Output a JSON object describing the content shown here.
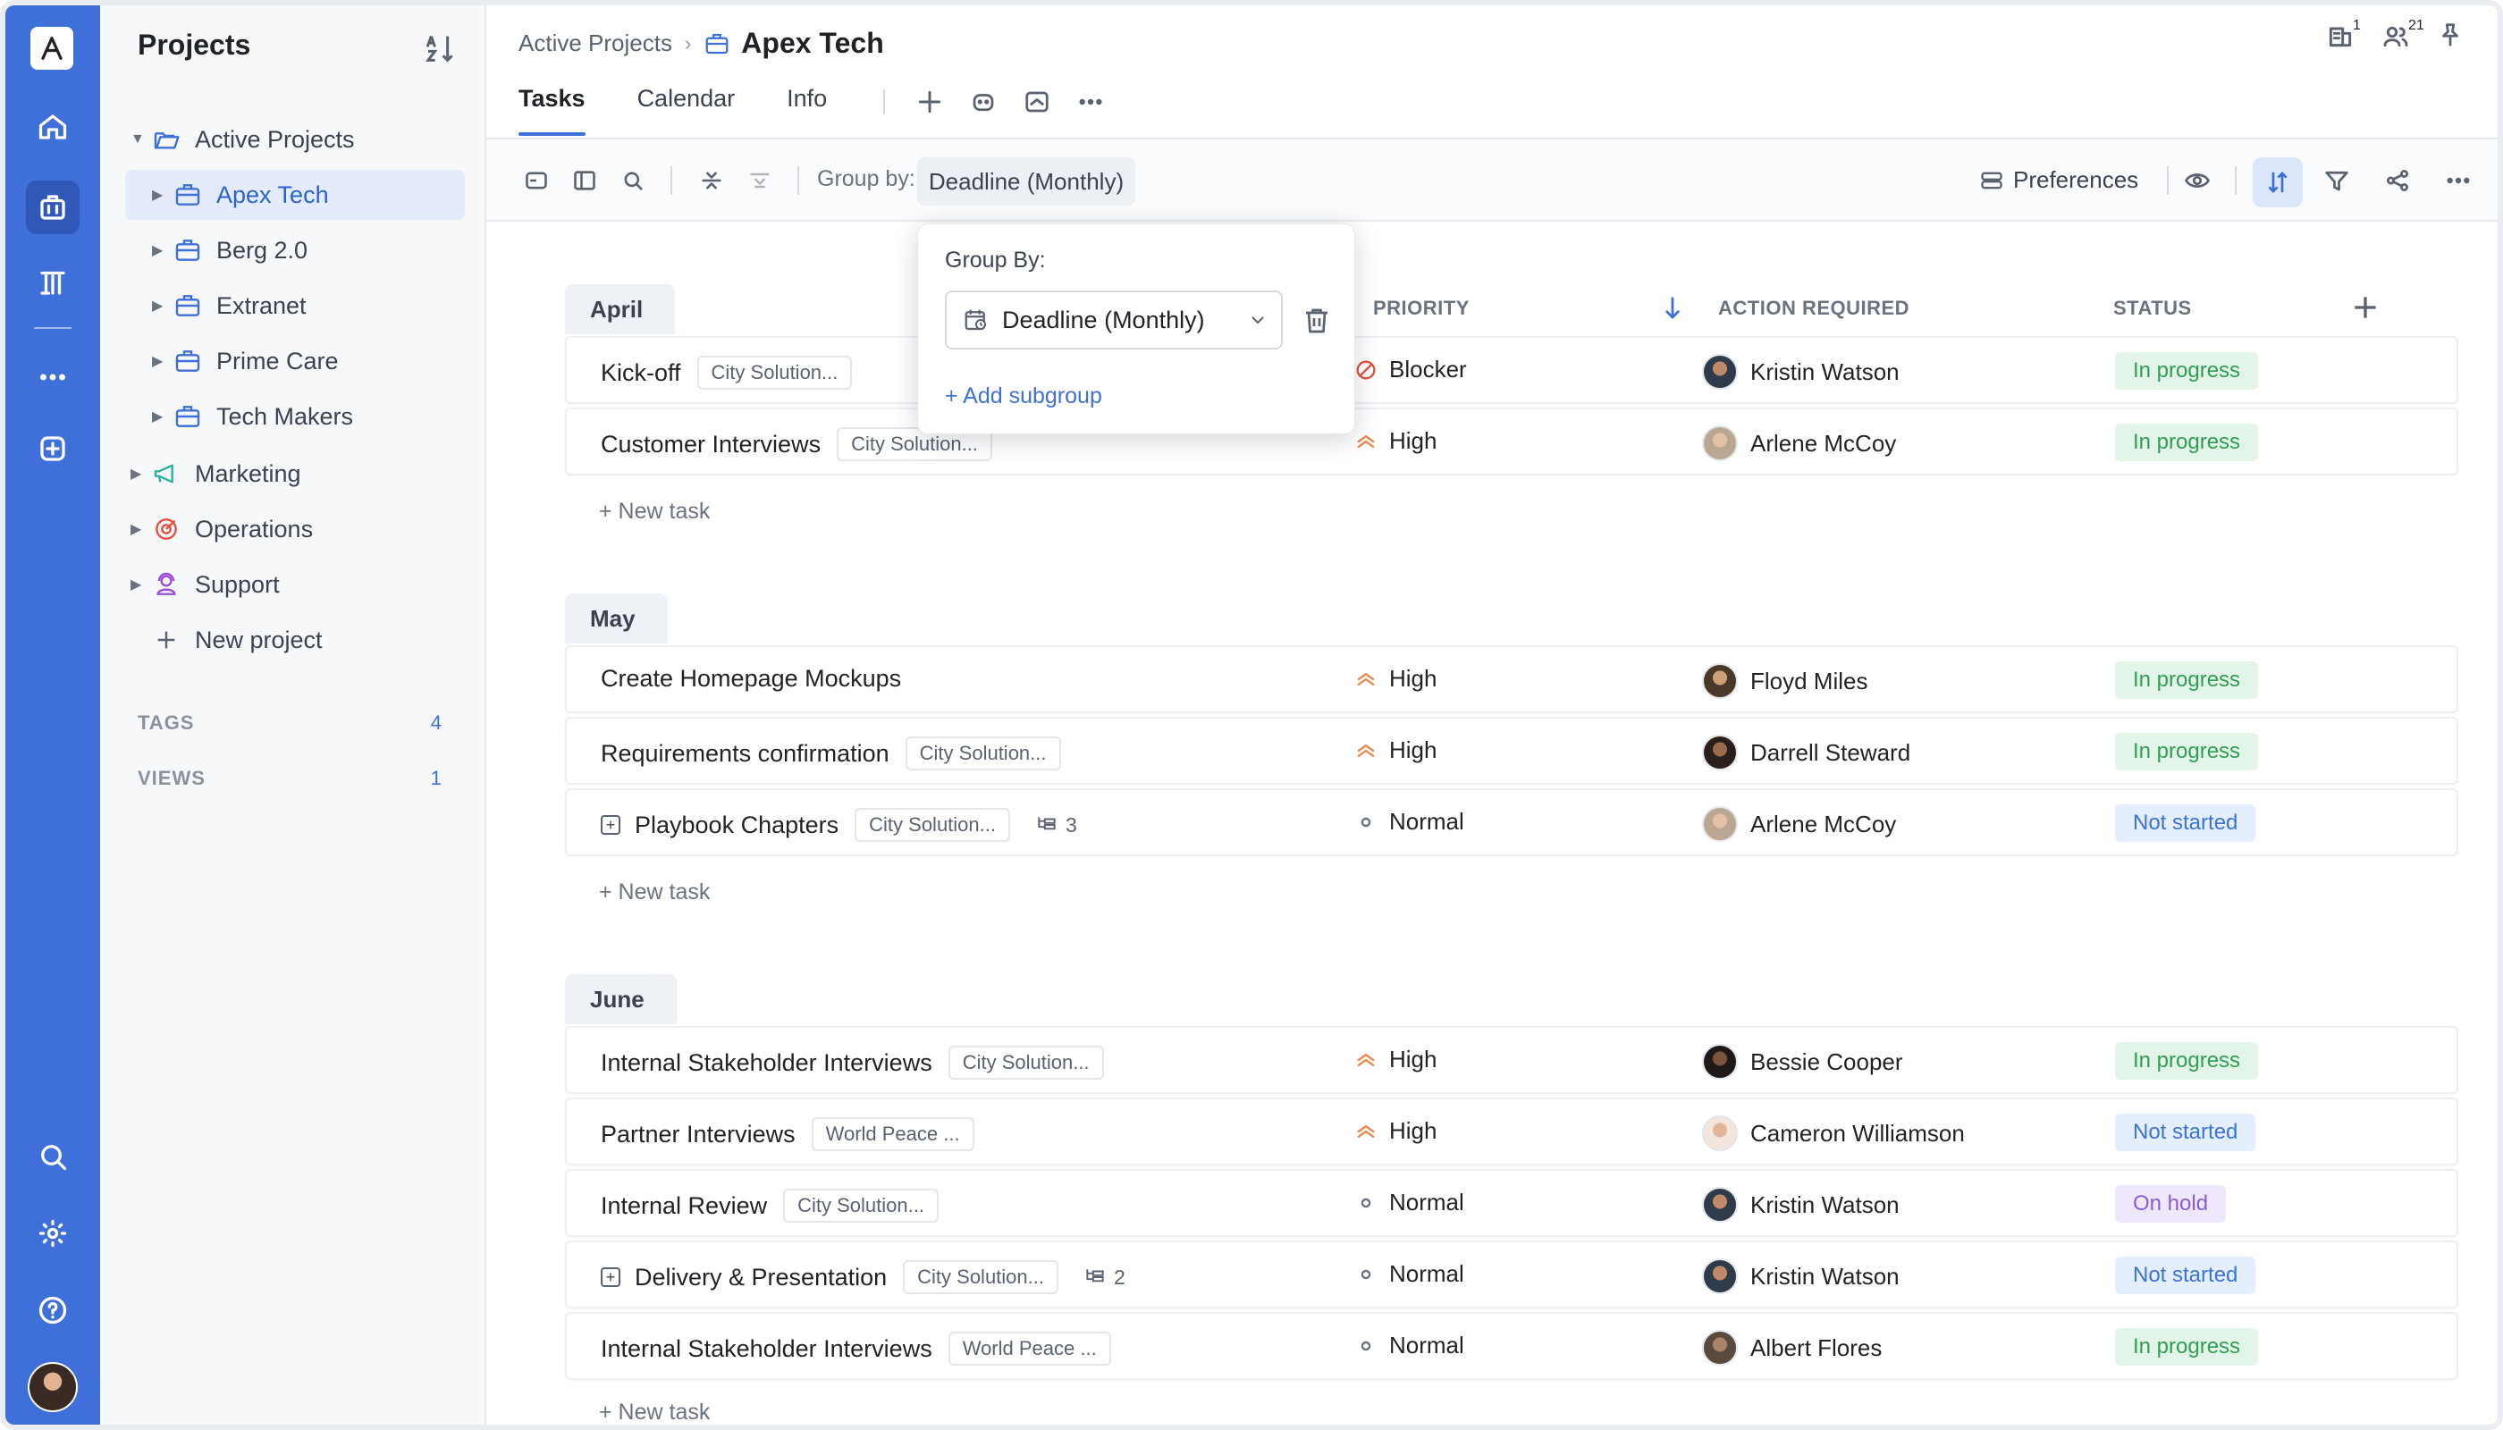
{
  "sidebar": {
    "title": "Projects",
    "items": [
      {
        "label": "Active Projects"
      },
      {
        "label": "Apex Tech"
      },
      {
        "label": "Berg 2.0"
      },
      {
        "label": "Extranet"
      },
      {
        "label": "Prime Care"
      },
      {
        "label": "Tech Makers"
      },
      {
        "label": "Marketing"
      },
      {
        "label": "Operations"
      },
      {
        "label": "Support"
      },
      {
        "label": "New project"
      }
    ],
    "tags_label": "TAGS",
    "tags_count": "4",
    "views_label": "VIEWS",
    "views_count": "1"
  },
  "header": {
    "breadcrumb_parent": "Active Projects",
    "breadcrumb_current": "Apex Tech",
    "notif_count_a": "1",
    "notif_count_b": "21"
  },
  "tabs": [
    {
      "label": "Tasks"
    },
    {
      "label": "Calendar"
    },
    {
      "label": "Info"
    }
  ],
  "toolbar": {
    "group_by_label": "Group by:",
    "group_by_value": "Deadline (Monthly)",
    "preferences_label": "Preferences"
  },
  "popup": {
    "title": "Group By:",
    "select_value": "Deadline (Monthly)",
    "add_subgroup": "+ Add subgroup"
  },
  "columns": {
    "priority": "PRIORITY",
    "action_required": "ACTION REQUIRED",
    "status": "STATUS"
  },
  "new_task_label": "+ New task",
  "groups": [
    {
      "name": "April",
      "tasks": [
        {
          "title": "Kick-off",
          "tag": "City Solution...",
          "subtasks": "",
          "priority": "Blocker",
          "person": "Kristin Watson",
          "status": "In progress"
        },
        {
          "title": "Customer Interviews",
          "tag": "City Solution...",
          "subtasks": "",
          "priority": "High",
          "person": "Arlene McCoy",
          "status": "In progress"
        }
      ]
    },
    {
      "name": "May",
      "tasks": [
        {
          "title": "Create Homepage Mockups",
          "tag": "",
          "subtasks": "",
          "priority": "High",
          "person": "Floyd Miles",
          "status": "In progress"
        },
        {
          "title": "Requirements confirmation",
          "tag": "City Solution...",
          "subtasks": "",
          "priority": "High",
          "person": "Darrell Steward",
          "status": "In progress"
        },
        {
          "title": "Playbook Chapters",
          "tag": "City Solution...",
          "subtasks": "3",
          "priority": "Normal",
          "person": "Arlene McCoy",
          "status": "Not started"
        }
      ]
    },
    {
      "name": "June",
      "tasks": [
        {
          "title": "Internal Stakeholder Interviews",
          "tag": "City Solution...",
          "subtasks": "",
          "priority": "High",
          "person": "Bessie Cooper",
          "status": "In progress"
        },
        {
          "title": "Partner Interviews",
          "tag": "World Peace ...",
          "subtasks": "",
          "priority": "High",
          "person": "Cameron Williamson",
          "status": "Not started"
        },
        {
          "title": "Internal Review",
          "tag": "City Solution...",
          "subtasks": "",
          "priority": "Normal",
          "person": "Kristin Watson",
          "status": "On hold"
        },
        {
          "title": "Delivery & Presentation",
          "tag": "City Solution...",
          "subtasks": "2",
          "priority": "Normal",
          "person": "Kristin Watson",
          "status": "Not started"
        },
        {
          "title": "Internal Stakeholder Interviews",
          "tag": "World Peace ...",
          "subtasks": "",
          "priority": "Normal",
          "person": "Albert Flores",
          "status": "In progress"
        }
      ]
    }
  ],
  "colors": {
    "accent": "#3f6fd8",
    "in_progress": "#2f9e55",
    "not_started": "#3a73d9",
    "on_hold": "#8a5cd6",
    "priority_high": "#e8894a",
    "priority_blocker": "#e0513f"
  }
}
